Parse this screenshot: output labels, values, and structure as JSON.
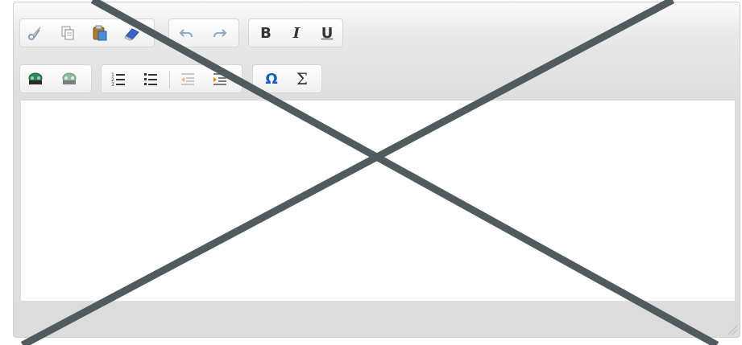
{
  "toolbar": {
    "clipboard": [
      "cut-icon",
      "copy-icon",
      "paste-icon",
      "eraser-icon"
    ],
    "history": [
      "undo-icon",
      "redo-icon"
    ],
    "format": [
      {
        "icon": "bold-icon",
        "label": "B"
      },
      {
        "icon": "italic-icon",
        "label": "I"
      },
      {
        "icon": "underline-icon",
        "label": "U"
      }
    ],
    "links": [
      "link-icon",
      "unlink-icon"
    ],
    "lists": [
      "numbered-list-icon",
      "bulleted-list-icon",
      "decrease-indent-icon",
      "increase-indent-icon"
    ],
    "insert": [
      {
        "icon": "omega-icon",
        "label": "Ω"
      },
      {
        "icon": "sigma-icon",
        "label": "Σ"
      }
    ]
  },
  "colors": {
    "overlay_cross": "#4f5b5c",
    "toolbar_bg": "#e9e9e9",
    "statusbar_bg": "#dcdcdc",
    "icon_blue": "#1a5fb4",
    "icon_orange": "#e67e22"
  }
}
